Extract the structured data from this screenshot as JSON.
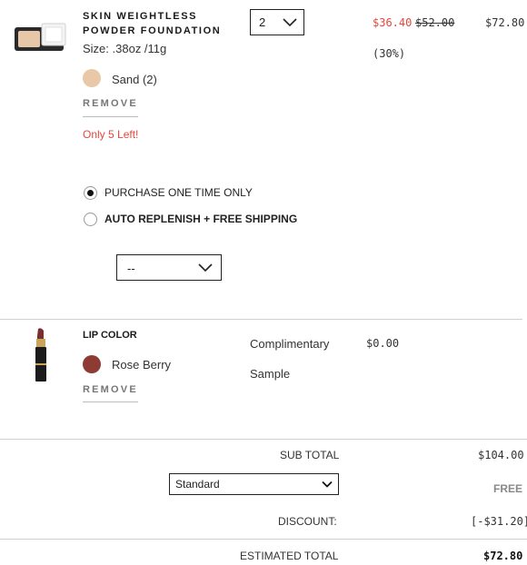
{
  "items": [
    {
      "name_line1": "SKIN WEIGHTLESS",
      "name_line2": "POWDER FOUNDATION",
      "size": "Size: .38oz /11g",
      "shade": "Sand (2)",
      "shade_color": "#e8c8a6",
      "remove_label": "REMOVE",
      "stock_note": "Only 5 Left!",
      "quantity": "2",
      "sale_price": "$36.40",
      "original_price": "$52.00",
      "discount_pct": "(30%)",
      "line_total": "$72.80"
    },
    {
      "name": "LIP COLOR",
      "shade": "Rose Berry",
      "shade_color": "#8e3b33",
      "remove_label": "REMOVE",
      "type_line1": "Complimentary",
      "type_line2": "Sample",
      "price": "$0.00"
    }
  ],
  "purchase_options": {
    "one_time": "PURCHASE ONE TIME ONLY",
    "auto_replenish": "AUTO REPLENISH + FREE SHIPPING",
    "frequency_value": "--"
  },
  "summary": {
    "subtotal_label": "SUB TOTAL",
    "subtotal_value": "$104.00",
    "shipping_option": "Standard",
    "shipping_value": "FREE",
    "discount_label": "DISCOUNT:",
    "discount_value": "[-$31.20]",
    "total_label": "ESTIMATED TOTAL",
    "total_value": "$72.80"
  },
  "colors": {
    "sale_red": "#e8453c",
    "stock_red": "#e8453c"
  }
}
